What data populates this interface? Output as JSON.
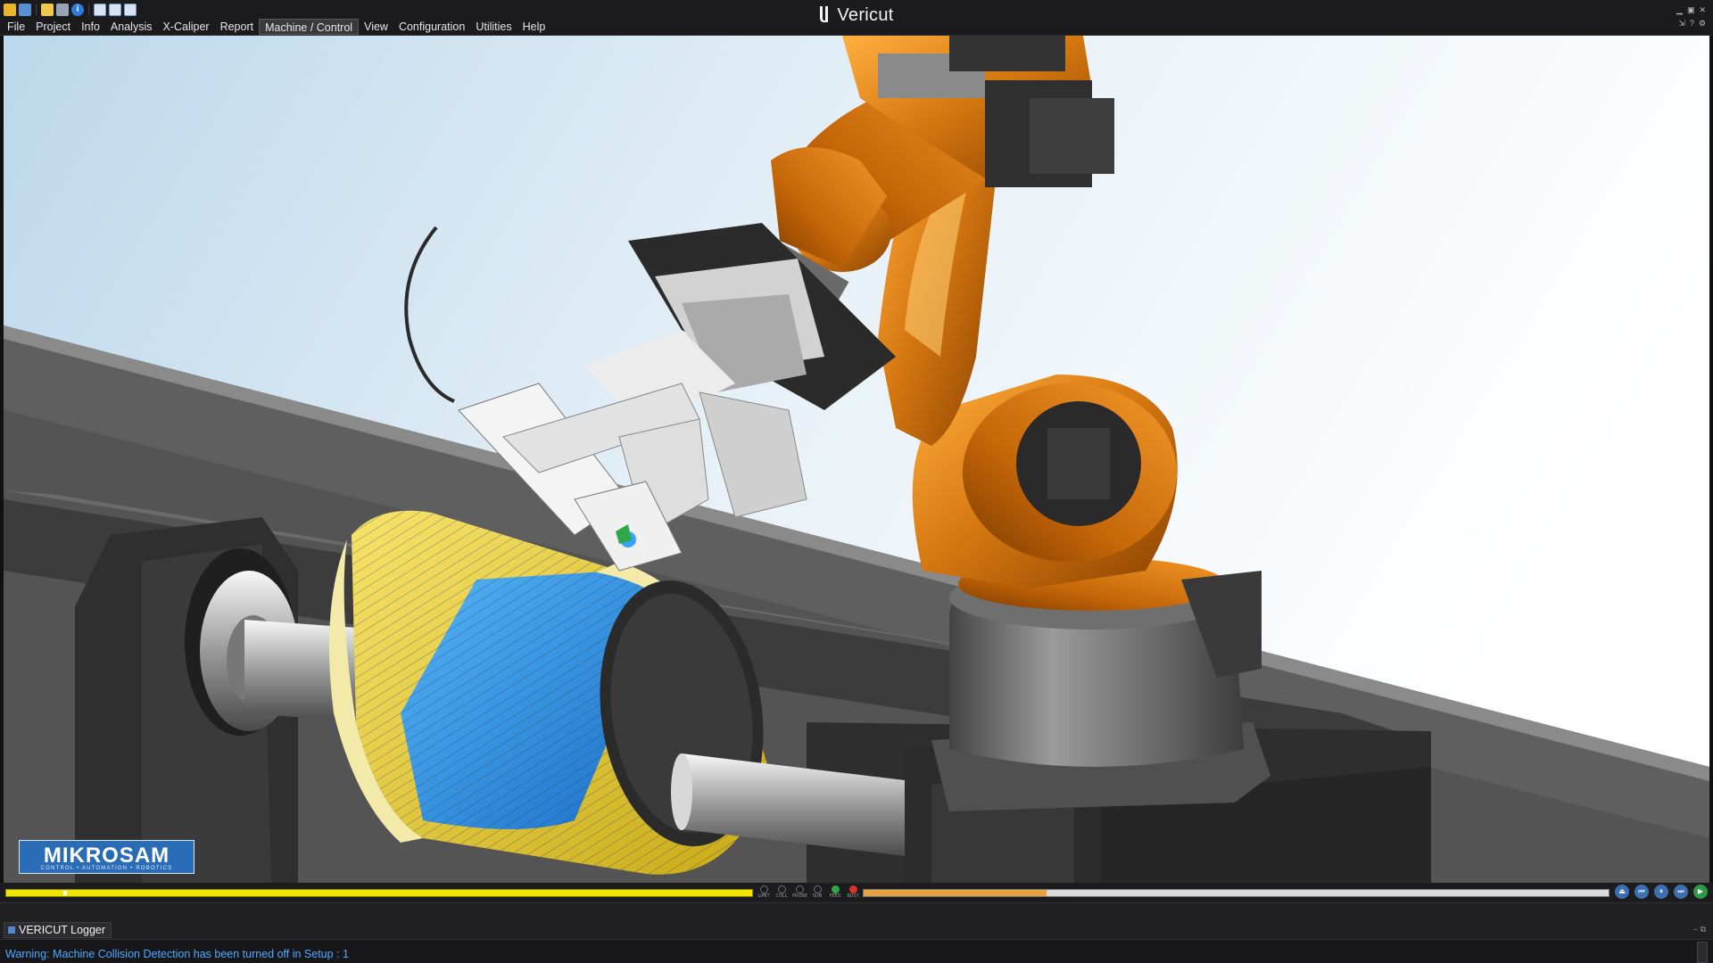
{
  "app": {
    "title": "Vericut"
  },
  "menu": {
    "items": [
      {
        "label": "File"
      },
      {
        "label": "Project"
      },
      {
        "label": "Info"
      },
      {
        "label": "Analysis"
      },
      {
        "label": "X-Caliper"
      },
      {
        "label": "Report"
      },
      {
        "label": "Machine / Control",
        "active": true
      },
      {
        "label": "View"
      },
      {
        "label": "Configuration"
      },
      {
        "label": "Utilities"
      },
      {
        "label": "Help"
      }
    ]
  },
  "quick_access": {
    "icons": [
      "open-folder-icon",
      "save-icon",
      "open-file-icon",
      "save-as-icon",
      "info-icon",
      "layout-single-icon",
      "layout-split-icon",
      "layout-stacked-icon"
    ]
  },
  "watermark": {
    "brand": "MIKROSAM",
    "tagline": "CONTROL • AUTOMATION • ROBOTICS"
  },
  "simulation": {
    "left_progress": 1.0,
    "left_marker": 0.076,
    "right_progress": 0.245,
    "indicators": [
      {
        "label": "LIMIT",
        "color": "#6e6e6e"
      },
      {
        "label": "COLL",
        "color": "#6e6e6e"
      },
      {
        "label": "PROBE",
        "color": "#6e6e6e"
      },
      {
        "label": "SUB",
        "color": "#6e6e6e"
      },
      {
        "label": "FEED",
        "color": "#2fa84a"
      },
      {
        "label": "BUSY",
        "color": "#d93030"
      }
    ],
    "playback": [
      "reset-icon",
      "rewind-icon",
      "pause-icon",
      "step-icon",
      "play-icon"
    ]
  },
  "logger": {
    "tab_label": "VERICUT Logger",
    "message": "Warning: Machine Collision Detection has been turned off in Setup : 1"
  },
  "colors": {
    "accent_progress": "#f0e400",
    "right_progress_fill": "#e5a13c",
    "robot_orange": "#d87a12",
    "composite_yellow": "#e8d030",
    "composite_blue": "#2e8fe0",
    "log_text": "#4fa9ff"
  }
}
